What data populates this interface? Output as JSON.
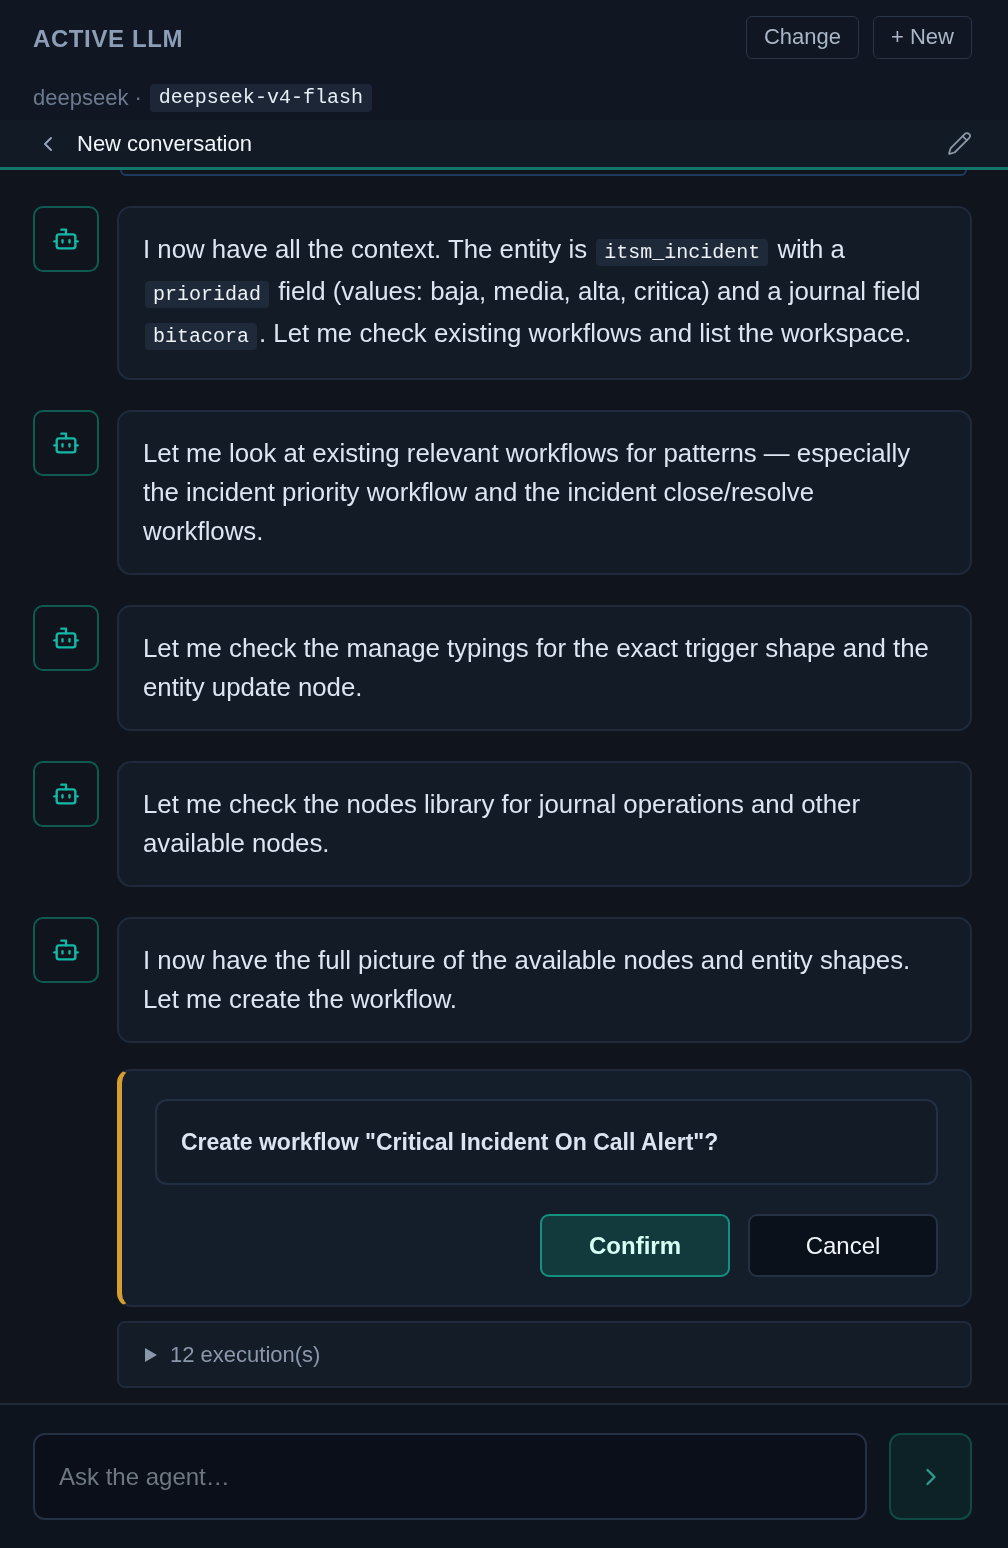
{
  "header": {
    "title": "ACTIVE LLM",
    "buttons": [
      {
        "label": "Change"
      },
      {
        "label": "+ New"
      }
    ],
    "provider": "deepseek ·",
    "model": "deepseek-v4-flash"
  },
  "conversation": {
    "title": "New conversation"
  },
  "messages": [
    {
      "segments": [
        {
          "kind": "text",
          "text": "I now have all the context. The entity is "
        },
        {
          "kind": "code",
          "text": "itsm_incident"
        },
        {
          "kind": "text",
          "text": " with a "
        },
        {
          "kind": "code",
          "text": "prioridad"
        },
        {
          "kind": "text",
          "text": " field (values: baja, media, alta, critica) and a journal field "
        },
        {
          "kind": "code",
          "text": "bitacora"
        },
        {
          "kind": "text",
          "text": ". Let me check existing workflows and list the workspace."
        }
      ]
    },
    {
      "segments": [
        {
          "kind": "text",
          "text": "Let me look at existing relevant workflows for patterns — especially the incident priority workflow and the incident close/resolve workflows."
        }
      ]
    },
    {
      "segments": [
        {
          "kind": "text",
          "text": "Let me check the manage typings for the exact trigger shape and the entity update node."
        }
      ]
    },
    {
      "segments": [
        {
          "kind": "text",
          "text": "Let me check the nodes library for journal operations and other available nodes."
        }
      ]
    },
    {
      "segments": [
        {
          "kind": "text",
          "text": "I now have the full picture of the available nodes and entity shapes. Let me create the workflow."
        }
      ]
    }
  ],
  "confirmation": {
    "question": "Create workflow \"Critical Incident On Call Alert\"?",
    "buttons": [
      {
        "label": "Confirm",
        "kind": "primary"
      },
      {
        "label": "Cancel",
        "kind": "secondary"
      }
    ]
  },
  "executions": {
    "label": "12 execution(s)",
    "expanded": false
  },
  "composer": {
    "placeholder": "Ask the agent…"
  }
}
